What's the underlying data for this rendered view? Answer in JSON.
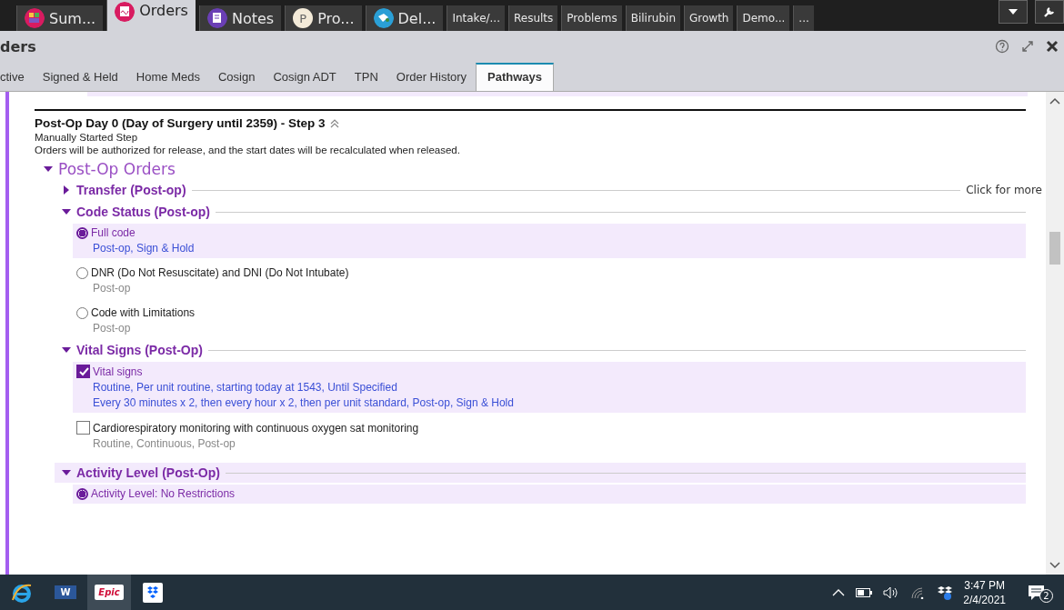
{
  "app_tabs": [
    {
      "label": "Sum...",
      "selected": false,
      "kind": "grid",
      "color": "#d81b60"
    },
    {
      "label": "Orders",
      "selected": true,
      "kind": "pen",
      "color": "#d81b60"
    },
    {
      "label": "Notes",
      "selected": false,
      "kind": "note",
      "color": "#6a3fb5"
    },
    {
      "label": "Pro...",
      "selected": false,
      "kind": "letter",
      "icon_text": "P",
      "color": "#f3ead8"
    },
    {
      "label": "Del...",
      "selected": false,
      "kind": "bird",
      "color": "#2a9fd6"
    },
    {
      "label": "Intake/...",
      "selected": false
    },
    {
      "label": "Results",
      "selected": false
    },
    {
      "label": "Problems",
      "selected": false
    },
    {
      "label": "Bilirubin",
      "selected": false
    },
    {
      "label": "Growth",
      "selected": false
    },
    {
      "label": "Demo...",
      "selected": false
    },
    {
      "label": "...",
      "selected": false
    }
  ],
  "activity": {
    "title": "ders"
  },
  "sub_tabs": [
    {
      "label": "ctive",
      "selected": false
    },
    {
      "label": "Signed & Held",
      "selected": false
    },
    {
      "label": "Home Meds",
      "selected": false
    },
    {
      "label": "Cosign",
      "selected": false
    },
    {
      "label": "Cosign ADT",
      "selected": false
    },
    {
      "label": "TPN",
      "selected": false
    },
    {
      "label": "Order History",
      "selected": false
    },
    {
      "label": "Pathways",
      "selected": true
    }
  ],
  "step": {
    "title": "Post-Op Day 0 (Day of Surgery until 2359) - Step 3",
    "subtitle": "Manually Started Step",
    "note": "Orders will be authorized for release, and the start dates will be recalculated when released."
  },
  "order_group": {
    "title": "Post-Op Orders",
    "expanded": true,
    "sections": [
      {
        "title": "Transfer (Post-op)",
        "expanded": false,
        "link": "Click for more"
      },
      {
        "title": "Code Status (Post-op)",
        "expanded": true,
        "items": [
          {
            "kind": "radio",
            "selected": true,
            "name": "Full code",
            "details": [
              "Post-op, Sign & Hold"
            ]
          },
          {
            "kind": "radio",
            "selected": false,
            "name": "DNR (Do Not Resuscitate) and DNI (Do Not Intubate)",
            "details": [
              "Post-op"
            ]
          },
          {
            "kind": "radio",
            "selected": false,
            "name": "Code with Limitations",
            "details": [
              "Post-op"
            ]
          }
        ]
      },
      {
        "title": "Vital Signs (Post-Op)",
        "expanded": true,
        "items": [
          {
            "kind": "checkbox",
            "selected": true,
            "name": "Vital signs",
            "details": [
              "Routine, Per unit routine, starting today at 1543, Until Specified",
              "Every 30 minutes x 2, then every hour x 2, then per unit standard, Post-op, Sign & Hold"
            ]
          },
          {
            "kind": "checkbox",
            "selected": false,
            "name": "Cardiorespiratory monitoring with continuous oxygen sat monitoring",
            "details": [
              "Routine, Continuous, Post-op"
            ]
          }
        ]
      },
      {
        "title": "Activity Level (Post-Op)",
        "expanded": true,
        "items": [
          {
            "kind": "radio",
            "selected": true,
            "name": "Activity Level: No Restrictions"
          }
        ]
      }
    ]
  },
  "taskbar": {
    "apps": [
      {
        "kind": "browser",
        "selected": false
      },
      {
        "kind": "word",
        "label": "W",
        "selected": false
      },
      {
        "kind": "epic",
        "label": "Epic",
        "selected": true
      },
      {
        "kind": "dropbox",
        "selected": false
      }
    ],
    "time": "3:47 PM",
    "date": "2/4/2021",
    "notifications": "2"
  }
}
